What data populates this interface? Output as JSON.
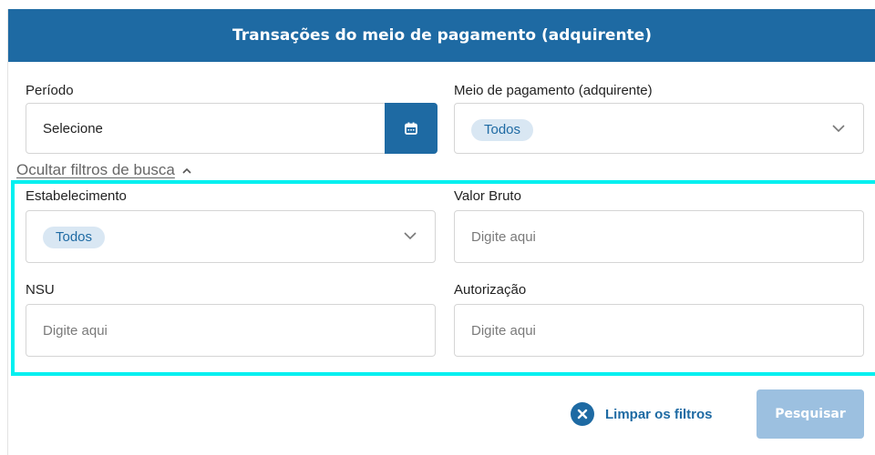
{
  "header": {
    "title": "Transações do meio de pagamento (adquirente)"
  },
  "filters": {
    "periodo": {
      "label": "Período",
      "value": "Selecione"
    },
    "meio_pagamento": {
      "label": "Meio de pagamento (adquirente)",
      "chip": "Todos"
    },
    "toggle_label": "Ocultar filtros de busca",
    "estabelecimento": {
      "label": "Estabelecimento",
      "chip": "Todos"
    },
    "valor_bruto": {
      "label": "Valor Bruto",
      "placeholder": "Digite aqui"
    },
    "nsu": {
      "label": "NSU",
      "placeholder": "Digite aqui"
    },
    "autorizacao": {
      "label": "Autorização",
      "placeholder": "Digite aqui"
    }
  },
  "actions": {
    "clear_label": "Limpar os filtros",
    "search_label": "Pesquisar"
  },
  "colors": {
    "primary": "#1e6aa3",
    "chip_bg": "#d9e7f3",
    "search_disabled": "#9cc0e0",
    "highlight": "#00f0f0"
  }
}
